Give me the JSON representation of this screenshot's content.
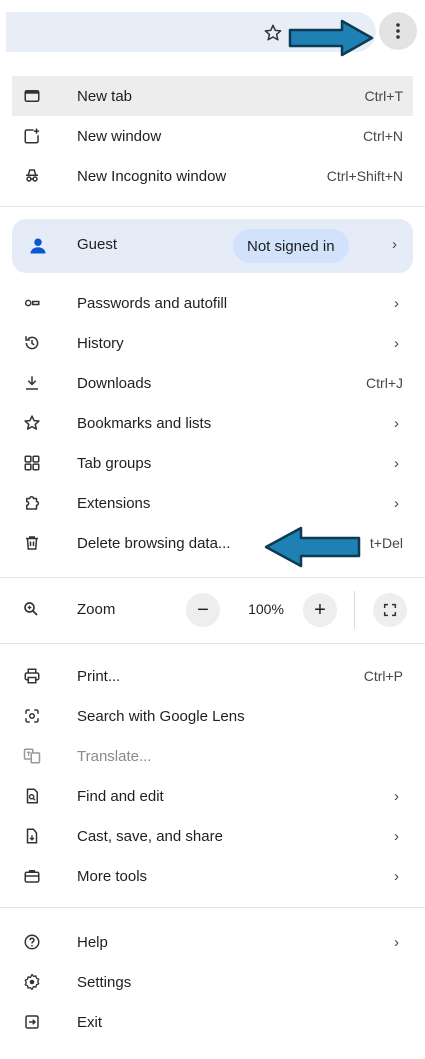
{
  "menu": {
    "new_tab": {
      "label": "New tab",
      "shortcut": "Ctrl+T",
      "icon": "new-tab-icon"
    },
    "new_window": {
      "label": "New window",
      "shortcut": "Ctrl+N",
      "icon": "new-window-icon"
    },
    "new_incognito": {
      "label": "New Incognito window",
      "shortcut": "Ctrl+Shift+N",
      "icon": "incognito-icon"
    },
    "profile": {
      "label": "Guest",
      "badge": "Not signed in",
      "chevron": "›",
      "icon": "person-icon"
    },
    "passwords": {
      "label": "Passwords and autofill",
      "chevron": "›",
      "icon": "key-icon"
    },
    "history": {
      "label": "History",
      "chevron": "›",
      "icon": "history-icon"
    },
    "downloads": {
      "label": "Downloads",
      "shortcut": "Ctrl+J",
      "icon": "download-icon"
    },
    "bookmarks": {
      "label": "Bookmarks and lists",
      "chevron": "›",
      "icon": "star-icon"
    },
    "tab_groups": {
      "label": "Tab groups",
      "chevron": "›",
      "icon": "tab-groups-icon"
    },
    "extensions": {
      "label": "Extensions",
      "chevron": "›",
      "icon": "extension-icon"
    },
    "delete_data": {
      "label": "Delete browsing data...",
      "shortcut": "t+Del",
      "icon": "trash-icon"
    },
    "zoom": {
      "label": "Zoom",
      "value": "100%",
      "minus": "−",
      "plus": "+",
      "icon": "zoom-icon"
    },
    "print": {
      "label": "Print...",
      "shortcut": "Ctrl+P",
      "icon": "print-icon"
    },
    "lens": {
      "label": "Search with Google Lens",
      "icon": "lens-icon"
    },
    "translate": {
      "label": "Translate...",
      "icon": "translate-icon"
    },
    "find_edit": {
      "label": "Find and edit",
      "chevron": "›",
      "icon": "find-icon"
    },
    "cast": {
      "label": "Cast, save, and share",
      "chevron": "›",
      "icon": "cast-icon"
    },
    "more_tools": {
      "label": "More tools",
      "chevron": "›",
      "icon": "toolbox-icon"
    },
    "help": {
      "label": "Help",
      "chevron": "›",
      "icon": "help-icon"
    },
    "settings": {
      "label": "Settings",
      "icon": "gear-icon"
    },
    "exit": {
      "label": "Exit",
      "icon": "exit-icon"
    }
  },
  "colors": {
    "arrow_fill": "#1f80b3",
    "arrow_outline": "#0d3b52",
    "profile_bg": "#e5ecf8",
    "hover_bg": "#ededed"
  }
}
